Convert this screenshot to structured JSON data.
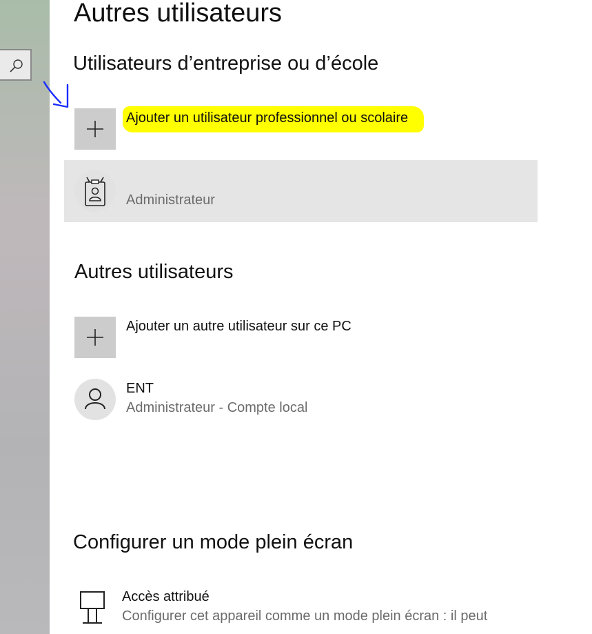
{
  "page": {
    "title": "Autres utilisateurs"
  },
  "sidebar": {
    "search_icon": "search-icon"
  },
  "work_school": {
    "heading": "Utilisateurs d’entreprise ou d’école",
    "add_label": "Ajouter un utilisateur professionnel ou scolaire",
    "highlight_color": "#ffff00",
    "account": {
      "name": "",
      "subtitle": "Administrateur",
      "icon": "id-badge-icon"
    }
  },
  "other_users": {
    "heading": "Autres utilisateurs",
    "add_label": "Ajouter un autre utilisateur sur ce PC",
    "user": {
      "name": "ENT",
      "subtitle": "Administrateur - Compte local",
      "icon": "person-icon"
    }
  },
  "kiosk": {
    "heading": "Configurer un mode plein écran",
    "item_title": "Accès attribué",
    "item_description": "Configurer cet appareil comme un mode plein écran : il peut",
    "icon": "kiosk-icon"
  },
  "annotation": {
    "arrow_color": "#0000ff"
  }
}
